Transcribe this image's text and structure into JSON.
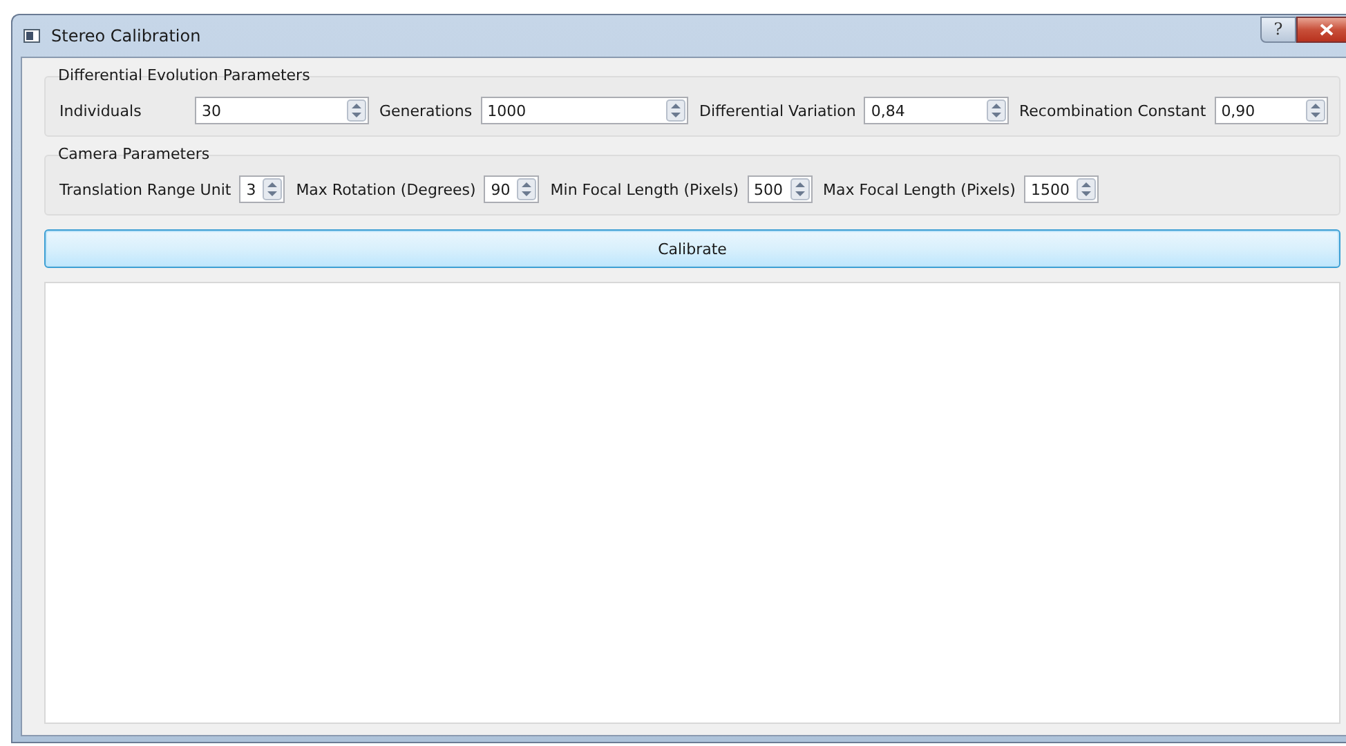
{
  "window": {
    "title": "Stereo Calibration",
    "help_button": "?"
  },
  "groups": [
    {
      "title": "Differential Evolution Parameters",
      "kind": "wide",
      "fields": [
        {
          "label": "Individuals",
          "value": "30"
        },
        {
          "label": "Generations",
          "value": "1000"
        },
        {
          "label": "Differential Variation",
          "value": "0,84"
        },
        {
          "label": "Recombination Constant",
          "value": "0,90"
        }
      ]
    },
    {
      "title": "Camera Parameters",
      "kind": "compact",
      "fields": [
        {
          "label": "Translation Range Unit",
          "value": "3"
        },
        {
          "label": "Max Rotation (Degrees)",
          "value": "90"
        },
        {
          "label": "Min Focal Length (Pixels)",
          "value": "500"
        },
        {
          "label": "Max Focal Length (Pixels)",
          "value": "1500"
        }
      ]
    }
  ],
  "calibrate_button": "Calibrate"
}
